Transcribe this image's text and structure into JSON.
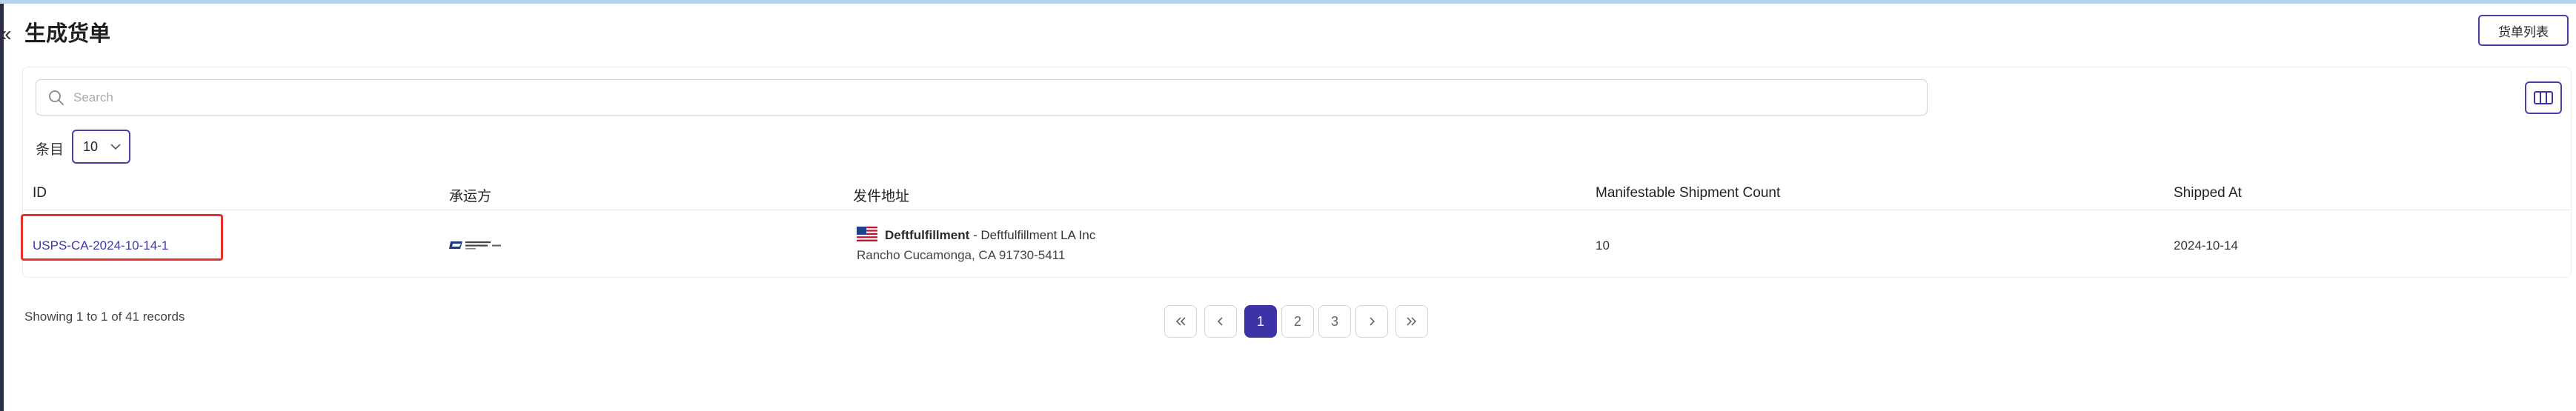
{
  "page": {
    "title": "生成货单",
    "collapse_glyph": "«",
    "manifest_list_button": "货单列表"
  },
  "toolbar": {
    "search_placeholder": "Search",
    "search_value": "",
    "per_page_label": "条目",
    "per_page_value": "10"
  },
  "table": {
    "columns": [
      "ID",
      "承运方",
      "发件地址",
      "Manifestable Shipment Count",
      "Shipped At"
    ],
    "rows": [
      {
        "id": "USPS-CA-2024-10-14-1",
        "carrier_logo": "usps-logo",
        "sender_name": "Deftfulfillment",
        "sender_company": " - Deftfulfillment LA Inc",
        "sender_city": "Rancho Cucamonga, CA 91730-5411",
        "count": "10",
        "shipped_at": "2024-10-14"
      }
    ]
  },
  "footer": {
    "records_text": "Showing 1 to 1 of 41 records",
    "pages": [
      "1",
      "2",
      "3"
    ],
    "current_page": "1"
  },
  "colors": {
    "accent": "#3d33a6",
    "highlight": "#e8302a",
    "link": "#3d3aa8"
  }
}
